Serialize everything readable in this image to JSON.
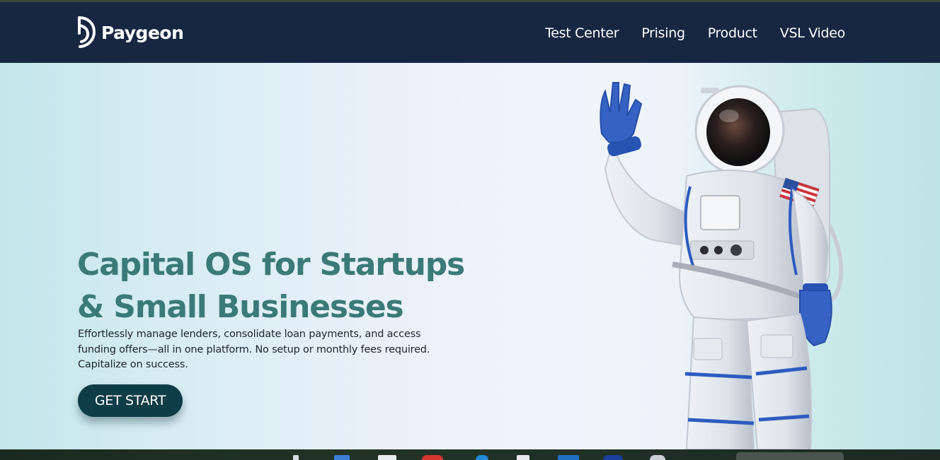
{
  "brand": {
    "name": "Paygeon"
  },
  "nav": {
    "items": [
      {
        "label": "Test Center"
      },
      {
        "label": "Prising"
      },
      {
        "label": "Product"
      },
      {
        "label": "VSL Video"
      }
    ]
  },
  "hero": {
    "title_line1": "Capital OS for Startups",
    "title_line2": "& Small Businesses",
    "subtitle_line1": "Effortlessly manage lenders, consolidate loan payments, and access",
    "subtitle_line2": "funding offers—all in one platform. No setup or monthly fees required.",
    "subtitle_line3": "Capitalize on success.",
    "cta_label": "GET START"
  },
  "colors": {
    "navbar_bg": "#172742",
    "headline": "#3a7a78",
    "cta_bg": "#0f3d47"
  },
  "icons": {
    "logo": "paygeon-logo-icon"
  },
  "taskbar": {
    "icons": [
      "folder-icon",
      "photos-icon",
      "mail-icon",
      "chrome-icon",
      "edge-icon",
      "settings-icon",
      "store-icon",
      "app-icon",
      "app-icon"
    ]
  }
}
